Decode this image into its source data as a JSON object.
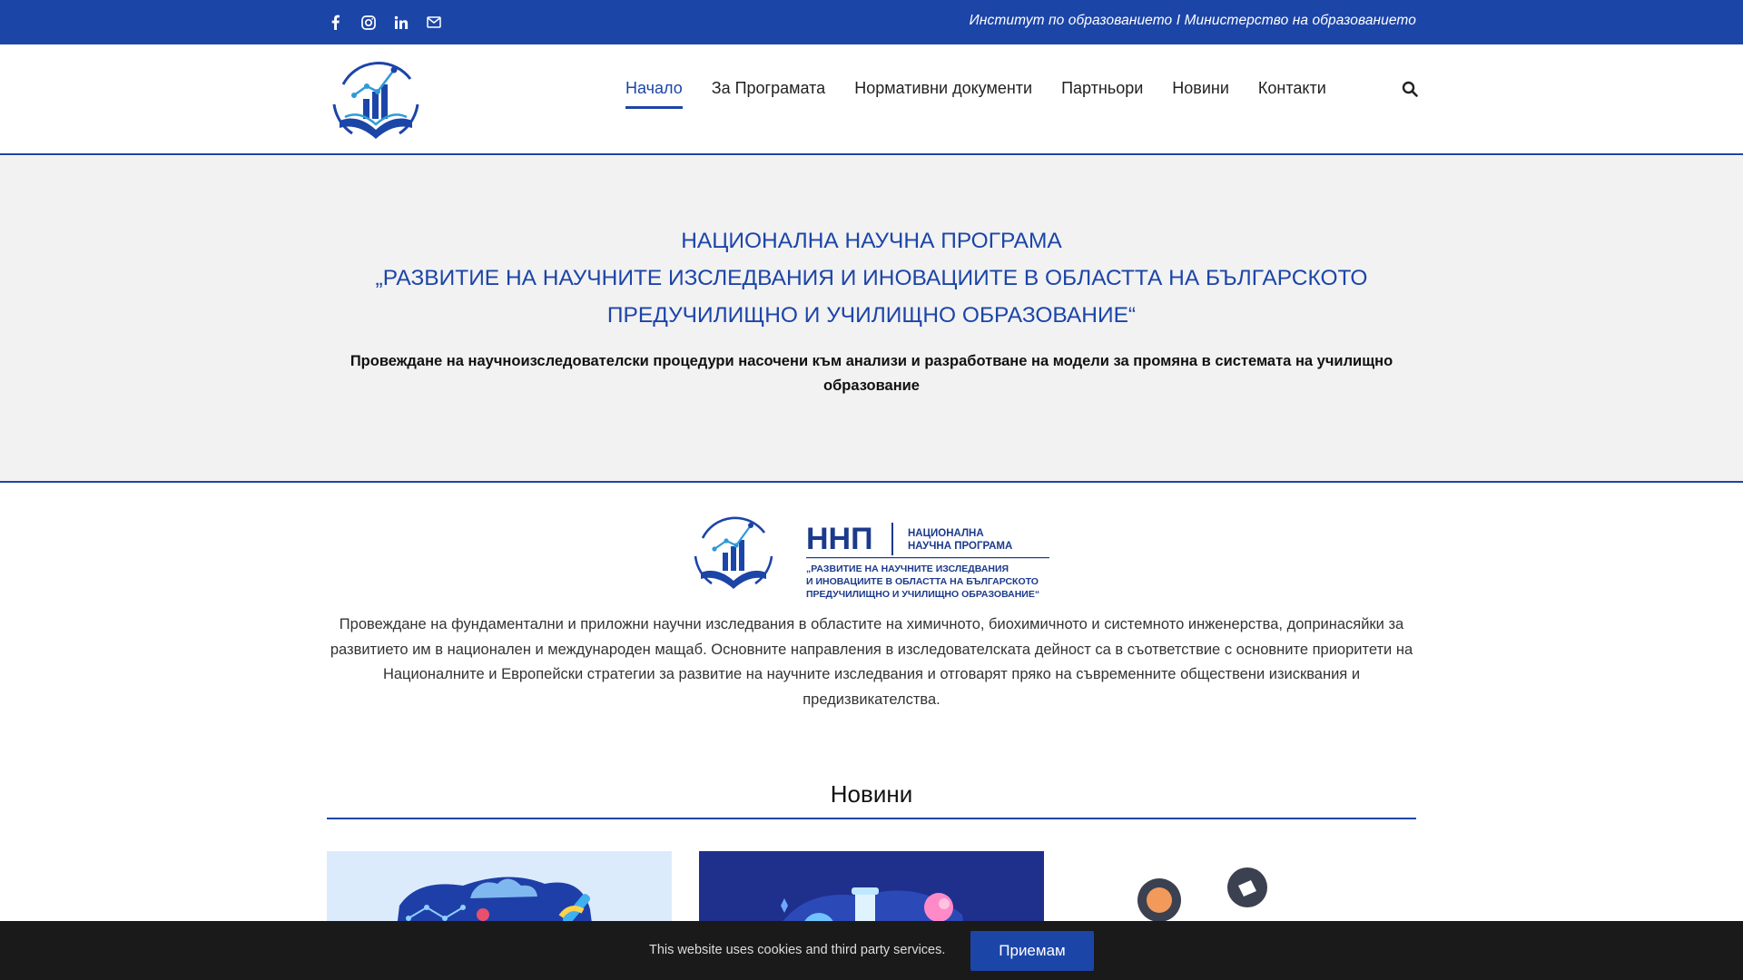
{
  "topbar": {
    "social_icons": [
      "facebook-icon",
      "instagram-icon",
      "linkedin-icon",
      "mail-icon"
    ],
    "right_text": "Институт по образованието I Министерство на образованието"
  },
  "nav": {
    "items": [
      "Начало",
      "За Програмата",
      "Нормативни документи",
      "Партньори",
      "Новини",
      "Контакти"
    ],
    "active_index": 0,
    "search_icon": "search-icon"
  },
  "hero": {
    "title_line1": "НАЦИОНАЛНА НАУЧНА ПРОГРАМА",
    "title_line2": "„РАЗВИТИЕ НА НАУЧНИТЕ ИЗСЛЕДВАНИЯ И ИНОВАЦИИТЕ В ОБЛАСТТА НА БЪЛГАРСКОТО",
    "title_line3": "ПРЕДУЧИЛИЩНО И УЧИЛИЩНО ОБРАЗОВАНИЕ“",
    "subtitle": "Провеждане на научноизследователски процедури насочени към анализи и разработване на модели за промяна в системата на училищно образование"
  },
  "banner": {
    "abbr": "ННП",
    "line1": "НАЦИОНАЛНА",
    "line2": "НАУЧНА ПРОГРАМА",
    "line3": "„РАЗВИТИЕ НА НАУЧНИТЕ ИЗСЛЕДВАНИЯ",
    "line4": "И ИНОВАЦИИТЕ В ОБЛАСТТА НА БЪЛГАРСКОТО",
    "line5": "ПРЕДУЧИЛИЩНО И УЧИЛИЩНО ОБРАЗОВАНИЕ“"
  },
  "description": "Провеждане на фундаментални и приложни научни изследвания в областите на химичното, биохимичното и системното инженерства, допринасяйки за развитието им в национален и международен мащаб. Основните направления в изследователската дейност са в съответствие с основните приоритети на Националните и Европейски стратегии за развитие на научните изследвания и отговарят пряко на съвременните обществени изисквания и предизвикателства.",
  "news": {
    "heading": "Новини"
  },
  "cookie": {
    "text": "This website uses cookies and third party services.",
    "button": "Приемам"
  },
  "colors": {
    "brand": "#1c45a8",
    "hero_bg": "#f2f2f2",
    "cookie_bg": "#1a1a1a"
  }
}
